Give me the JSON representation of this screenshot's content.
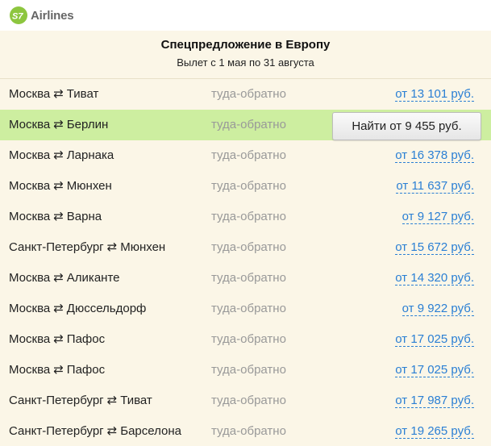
{
  "brand": {
    "name": "Airlines",
    "logo_icon": "s7-logo-icon",
    "accent": "#8dc63f"
  },
  "offer": {
    "title": "Спецпредложение в Европу",
    "subtitle": "Вылет с 1 мая по 31 августа"
  },
  "arrow_glyph": "⇄",
  "routes": [
    {
      "from": "Москва",
      "to": "Тиват",
      "type": "туда-обратно",
      "price": "от 13 101 руб."
    },
    {
      "from": "Москва",
      "to": "Берлин",
      "type": "туда-обратно",
      "price": "",
      "highlighted": true,
      "button": "Найти от 9 455 руб."
    },
    {
      "from": "Москва",
      "to": "Ларнака",
      "type": "туда-обратно",
      "price": "от 16 378 руб."
    },
    {
      "from": "Москва",
      "to": "Мюнхен",
      "type": "туда-обратно",
      "price": "от 11 637 руб."
    },
    {
      "from": "Москва",
      "to": "Варна",
      "type": "туда-обратно",
      "price": "от 9 127 руб."
    },
    {
      "from": "Санкт-Петербург",
      "to": "Мюнхен",
      "type": "туда-обратно",
      "price": "от 15 672 руб."
    },
    {
      "from": "Москва",
      "to": "Аликанте",
      "type": "туда-обратно",
      "price": "от 14 320 руб."
    },
    {
      "from": "Москва",
      "to": "Дюссельдорф",
      "type": "туда-обратно",
      "price": "от 9 922 руб."
    },
    {
      "from": "Москва",
      "to": "Пафос",
      "type": "туда-обратно",
      "price": "от 17 025 руб."
    },
    {
      "from": "Москва",
      "to": "Пафос",
      "type": "туда-обратно",
      "price": "от 17 025 руб."
    },
    {
      "from": "Санкт-Петербург",
      "to": "Тиват",
      "type": "туда-обратно",
      "price": "от 17 987 руб."
    },
    {
      "from": "Санкт-Петербург",
      "to": "Барселона",
      "type": "туда-обратно",
      "price": "от 19 265 руб."
    }
  ],
  "colors": {
    "panel_bg": "#fbf6e7",
    "highlight_bg": "#cdeea0",
    "link": "#2a7fd4",
    "muted": "#999999"
  }
}
